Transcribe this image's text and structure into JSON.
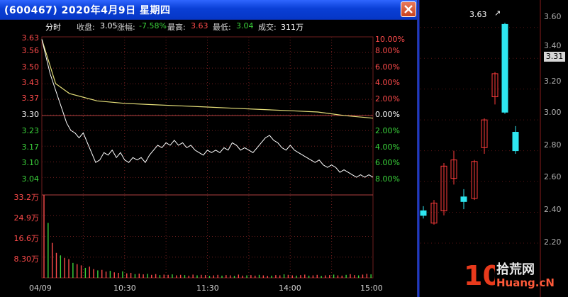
{
  "window": {
    "title": "(600467) 2020年4月9日 星期四",
    "close_glyph": "close-icon"
  },
  "info": {
    "section": "分时",
    "close_label": "收盘:",
    "close_value": "3.05",
    "change_label": "涨幅:",
    "change_value": "-7.58%",
    "high_label": "最高:",
    "high_value": "3.63",
    "low_label": "最低:",
    "low_value": "3.04",
    "volume_label": "成交:",
    "volume_value": "311万"
  },
  "price_axis": {
    "left_ticks": [
      "3.63",
      "3.56",
      "3.50",
      "3.43",
      "3.37",
      "3.30",
      "3.23",
      "3.17",
      "3.10",
      "3.04"
    ],
    "right_ticks": [
      "10.00%",
      "8.00%",
      "6.00%",
      "4.00%",
      "2.00%",
      "0.00%",
      "2.00%",
      "4.00%",
      "6.00%",
      "8.00%"
    ]
  },
  "volume_axis": {
    "ticks": [
      "33.2万",
      "24.9万",
      "16.6万",
      "8.30万"
    ]
  },
  "time_axis": {
    "ticks": [
      "04/09",
      "10:30",
      "11:30",
      "14:00",
      "15:00"
    ]
  },
  "colors": {
    "up": "#ff4b4b",
    "down": "#3bd43b",
    "price_line": "#ffffff",
    "avg_line": "#e6e07a",
    "grid": "#6e1e1e",
    "accent_title": "#0a3fd6",
    "candle_up": "#ff3b3b",
    "candle_down": "#2ee6f0"
  },
  "chart_data": [
    {
      "type": "line",
      "title": "分时",
      "x_unit": "minutes since open",
      "ylim": [
        3.04,
        3.63
      ],
      "series": [
        {
          "points": [
            [
              0,
              3.62
            ],
            [
              3,
              3.55
            ],
            [
              6,
              3.48
            ],
            [
              9,
              3.43
            ],
            [
              12,
              3.38
            ],
            [
              15,
              3.33
            ],
            [
              18,
              3.28
            ],
            [
              21,
              3.25
            ],
            [
              24,
              3.24
            ],
            [
              27,
              3.22
            ],
            [
              30,
              3.24
            ],
            [
              33,
              3.2
            ],
            [
              36,
              3.16
            ],
            [
              39,
              3.12
            ],
            [
              42,
              3.13
            ],
            [
              45,
              3.16
            ],
            [
              48,
              3.15
            ],
            [
              51,
              3.17
            ],
            [
              54,
              3.14
            ],
            [
              57,
              3.16
            ],
            [
              60,
              3.13
            ],
            [
              63,
              3.12
            ],
            [
              66,
              3.14
            ],
            [
              69,
              3.13
            ],
            [
              72,
              3.14
            ],
            [
              75,
              3.12
            ],
            [
              78,
              3.15
            ],
            [
              81,
              3.17
            ],
            [
              84,
              3.19
            ],
            [
              87,
              3.18
            ],
            [
              90,
              3.2
            ],
            [
              93,
              3.19
            ],
            [
              96,
              3.21
            ],
            [
              99,
              3.19
            ],
            [
              102,
              3.2
            ],
            [
              105,
              3.18
            ],
            [
              108,
              3.19
            ],
            [
              111,
              3.17
            ],
            [
              114,
              3.16
            ],
            [
              117,
              3.15
            ],
            [
              120,
              3.17
            ],
            [
              123,
              3.16
            ],
            [
              126,
              3.17
            ],
            [
              129,
              3.16
            ],
            [
              132,
              3.18
            ],
            [
              135,
              3.17
            ],
            [
              138,
              3.2
            ],
            [
              141,
              3.19
            ],
            [
              144,
              3.17
            ],
            [
              147,
              3.18
            ],
            [
              150,
              3.17
            ],
            [
              153,
              3.16
            ],
            [
              156,
              3.18
            ],
            [
              159,
              3.2
            ],
            [
              162,
              3.22
            ],
            [
              165,
              3.23
            ],
            [
              168,
              3.21
            ],
            [
              171,
              3.2
            ],
            [
              174,
              3.18
            ],
            [
              177,
              3.17
            ],
            [
              180,
              3.19
            ],
            [
              183,
              3.17
            ],
            [
              186,
              3.16
            ],
            [
              189,
              3.15
            ],
            [
              192,
              3.14
            ],
            [
              195,
              3.13
            ],
            [
              198,
              3.12
            ],
            [
              201,
              3.13
            ],
            [
              204,
              3.11
            ],
            [
              207,
              3.1
            ],
            [
              210,
              3.11
            ],
            [
              213,
              3.1
            ],
            [
              216,
              3.08
            ],
            [
              219,
              3.09
            ],
            [
              222,
              3.08
            ],
            [
              225,
              3.07
            ],
            [
              228,
              3.06
            ],
            [
              231,
              3.07
            ],
            [
              234,
              3.06
            ],
            [
              237,
              3.07
            ],
            [
              240,
              3.06
            ]
          ]
        },
        {
          "points": [
            [
              0,
              3.62
            ],
            [
              10,
              3.44
            ],
            [
              20,
              3.4
            ],
            [
              40,
              3.37
            ],
            [
              60,
              3.36
            ],
            [
              80,
              3.355
            ],
            [
              100,
              3.35
            ],
            [
              120,
              3.345
            ],
            [
              140,
              3.34
            ],
            [
              160,
              3.335
            ],
            [
              180,
              3.33
            ],
            [
              200,
              3.325
            ],
            [
              220,
              3.31
            ],
            [
              240,
              3.3
            ]
          ]
        }
      ]
    },
    {
      "type": "bar",
      "ylim": [
        0,
        33.2
      ],
      "values": [
        33.2,
        22,
        14,
        10,
        9,
        8,
        7.5,
        6,
        5.5,
        5,
        4,
        4.5,
        3.5,
        3,
        3.2,
        2.5,
        2.8,
        2.2,
        2,
        2.6,
        1.8,
        2,
        1.5,
        1.7,
        1.4,
        1.6,
        1.2,
        1.5,
        1.1,
        1.3,
        1.2,
        1.4,
        1.0,
        1.2,
        1.1,
        0.9,
        1.3,
        1.0,
        1.2,
        1.1,
        0.8,
        1.0,
        1.2,
        0.9,
        1.1,
        1.0,
        0.8,
        1.3,
        0.9,
        1.0,
        1.1,
        0.9,
        1.2,
        1.0,
        0.8,
        0.9,
        1.1,
        1.0,
        1.4,
        1.2,
        1.0,
        0.9,
        1.1,
        1.3,
        0.9,
        1.0,
        1.2,
        0.8,
        1.0,
        1.1,
        1.3,
        1.0,
        0.9,
        1.2,
        1.5,
        1.1,
        1.0,
        1.3,
        1.6,
        1.4
      ]
    },
    {
      "type": "bar",
      "title": "日K线",
      "y_ticks": [
        "3.60",
        "3.40",
        "3.31",
        "3.20",
        "3.00",
        "2.80",
        "2.60",
        "2.40",
        "2.20"
      ],
      "high_marker": "3.63",
      "current_price": "3.31",
      "ylim": [
        2.2,
        3.7
      ],
      "candles": [
        {
          "open": 2.41,
          "close": 2.38,
          "high": 2.44,
          "low": 2.36
        },
        {
          "open": 2.33,
          "close": 2.46,
          "high": 2.48,
          "low": 2.32
        },
        {
          "open": 2.41,
          "close": 2.7,
          "high": 2.72,
          "low": 2.38
        },
        {
          "open": 2.62,
          "close": 2.74,
          "high": 2.8,
          "low": 2.58
        },
        {
          "open": 2.5,
          "close": 2.47,
          "high": 2.55,
          "low": 2.42
        },
        {
          "open": 2.49,
          "close": 2.73,
          "high": 2.74,
          "low": 2.48
        },
        {
          "open": 2.82,
          "close": 3.0,
          "high": 3.01,
          "low": 2.78
        },
        {
          "open": 3.15,
          "close": 3.3,
          "high": 3.31,
          "low": 3.1
        },
        {
          "open": 3.62,
          "close": 3.05,
          "high": 3.63,
          "low": 3.04
        },
        {
          "open": 2.92,
          "close": 2.8,
          "high": 2.96,
          "low": 2.78
        }
      ]
    }
  ],
  "watermark": {
    "line1": "拾荒网",
    "line2": "Huang.cN"
  }
}
